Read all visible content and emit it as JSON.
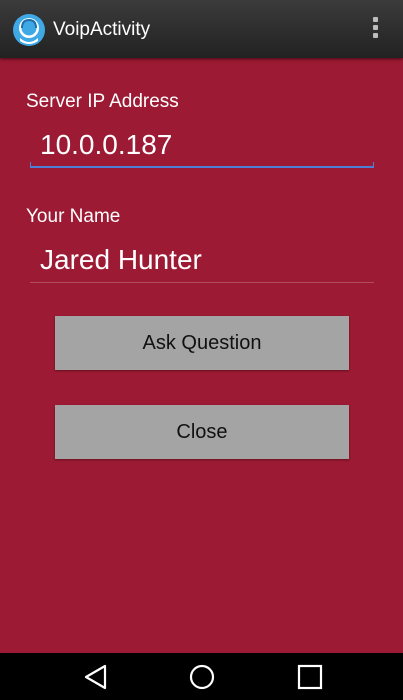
{
  "app": {
    "title": "VoipActivity",
    "icon": "chat-person-icon",
    "menu_icon": "overflow-menu-icon"
  },
  "form": {
    "server_label": "Server IP Address",
    "server_value": "10.0.0.187",
    "name_label": "Your Name",
    "name_value": "Jared Hunter"
  },
  "buttons": {
    "ask_label": "Ask Question",
    "close_label": "Close"
  },
  "nav": {
    "back_icon": "back-triangle-icon",
    "home_icon": "home-circle-icon",
    "recents_icon": "recents-square-icon"
  },
  "colors": {
    "background": "#9c1a33",
    "action_bar": "#2c2c2c",
    "focus_underline": "#4e7fd6",
    "button": "#a4a4a4"
  }
}
